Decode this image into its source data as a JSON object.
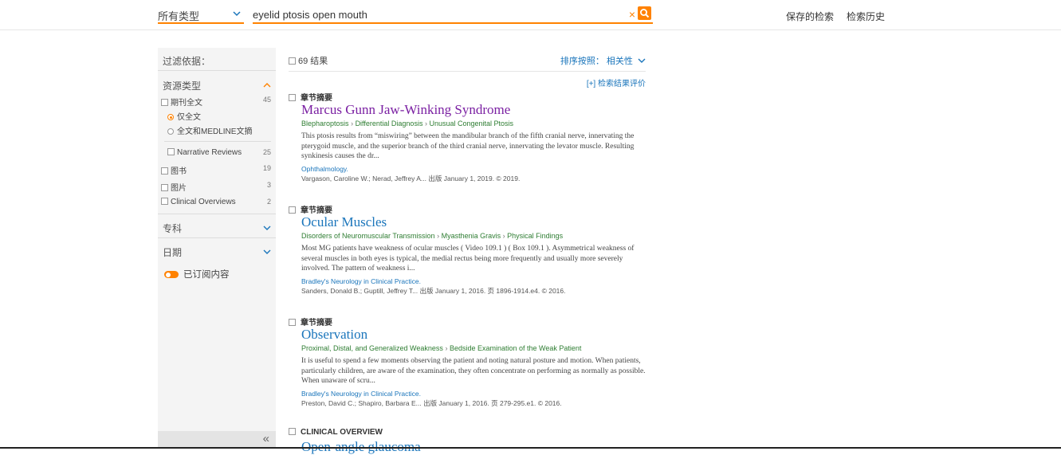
{
  "header": {
    "type_select": "所有类型",
    "search_value": "eyelid ptosis open mouth",
    "links": [
      "保存的检索",
      "检索历史"
    ]
  },
  "sidebar": {
    "title": "过滤依据：",
    "resource_type": "资源类型",
    "journal_fulltext": {
      "label": "期刊全文",
      "count": "45"
    },
    "radio_fulltext_only": "仅全文",
    "radio_fulltext_medline": "全文和MEDLINE文摘",
    "narrative_reviews": {
      "label": "Narrative Reviews",
      "count": "25"
    },
    "books": {
      "label": "图书",
      "count": "19"
    },
    "images": {
      "label": "图片",
      "count": "3"
    },
    "clinical_overviews": {
      "label": "Clinical Overviews",
      "count": "2"
    },
    "specialty": "专科",
    "date": "日期",
    "subscribed": "已订阅内容",
    "collapse": "«"
  },
  "results_header": {
    "count": "69 结果",
    "sort": "排序按照： 相关性",
    "evaluate": "[+] 检索结果评价"
  },
  "results": [
    {
      "type": "章节摘要",
      "title": "Marcus Gunn Jaw-Winking Syndrome",
      "breadcrumb": [
        "Blepharoptosis",
        "Differential Diagnosis",
        "Unusual Congenital Ptosis"
      ],
      "snippet": "This ptosis results from “miswiring” between the mandibular branch of the fifth cranial nerve, innervating the pterygoid muscle, and the superior branch of the third cranial nerve, innervating the levator muscle. Resulting synkinesis causes the dr...",
      "source": "Ophthalmology.",
      "meta": "Vargason, Caroline W.; Nerad, Jeffrey A... 出版 January 1, 2019. © 2019."
    },
    {
      "type": "章节摘要",
      "title": "Ocular Muscles",
      "breadcrumb": [
        "Disorders of Neuromuscular Transmission",
        "Myasthenia Gravis",
        "Physical Findings"
      ],
      "snippet": "Most MG patients have weakness of ocular muscles ( Video 109.1 ) ( Box 109.1 ). Asymmetrical weakness of several muscles in both eyes is typical, the medial rectus being more frequently and usually more severely involved. The pattern of weakness i...",
      "source": "Bradley's Neurology in Clinical Practice.",
      "meta": "Sanders, Donald B.; Guptill, Jeffrey T... 出版 January 1, 2016. 页 1896-1914.e4. © 2016."
    },
    {
      "type": "章节摘要",
      "title": "Observation",
      "breadcrumb": [
        "Proximal, Distal, and Generalized Weakness",
        "Bedside Examination of the Weak Patient"
      ],
      "snippet": "It is useful to spend a few moments observing the patient and noting natural posture and motion. When patients, particularly children, are aware of the examination, they often concentrate on performing as normally as possible. When unaware of scru...",
      "source": "Bradley's Neurology in Clinical Practice.",
      "meta": "Preston, David C.; Shapiro, Barbara E... 出版 January 1, 2016. 页 279-295.e1. © 2016."
    },
    {
      "type": "CLINICAL OVERVIEW",
      "title": "Open-angle glaucoma"
    }
  ],
  "colors": {
    "accent": "#ff8200",
    "link": "#1a75bb",
    "visited": "#7a1fa2",
    "breadcrumb": "#2e7d32"
  }
}
